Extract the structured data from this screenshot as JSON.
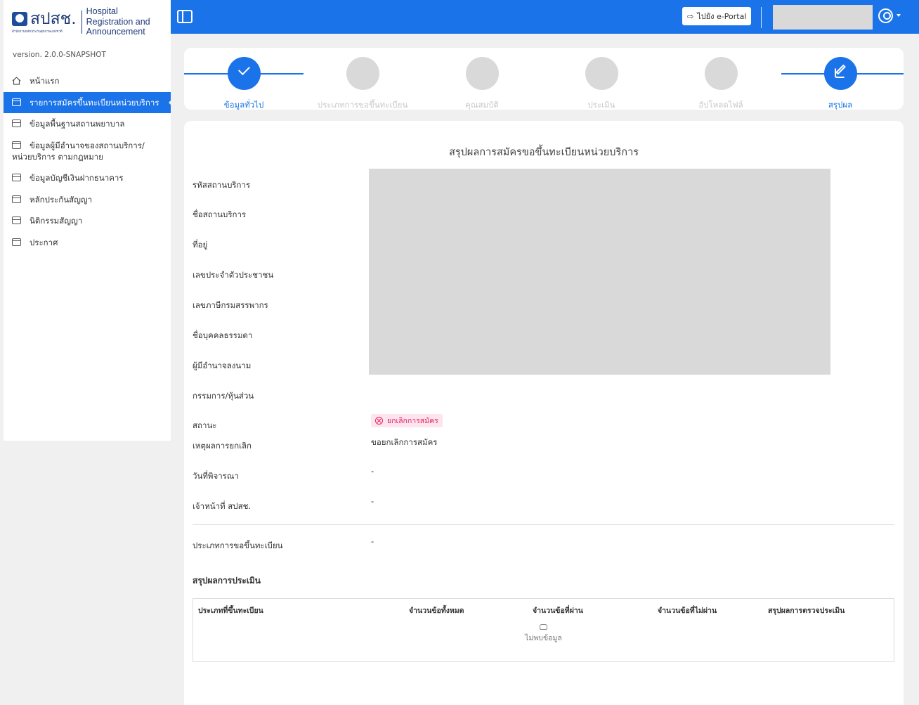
{
  "brand": {
    "logo_text": "สปสช.",
    "logo_subtext": "สำนักงานหลักประกันสุขภาพแห่งชาติ",
    "name_line1": "Hospital",
    "name_line2": "Registration and",
    "name_line3": "Announcement",
    "version": "version. 2.0.0-SNAPSHOT"
  },
  "sidebar": {
    "items": [
      {
        "label": "หน้าแรก",
        "icon": "home-icon"
      },
      {
        "label": "รายการสมัครขึ้นทะเบียนหน่วยบริการ",
        "icon": "card-icon",
        "active": true
      },
      {
        "label": "ข้อมูลพื้นฐานสถานพยาบาล",
        "icon": "card-icon"
      },
      {
        "label": "ข้อมูลผู้มีอำนาจของสถานบริการ/หน่วยบริการ ตามกฎหมาย",
        "icon": "card-icon"
      },
      {
        "label": "ข้อมูลบัญชีเงินฝากธนาคาร",
        "icon": "card-icon"
      },
      {
        "label": "หลักประกันสัญญา",
        "icon": "card-icon"
      },
      {
        "label": "นิติกรรมสัญญา",
        "icon": "card-icon"
      },
      {
        "label": "ประกาศ",
        "icon": "card-icon"
      }
    ]
  },
  "header": {
    "portal_button": "ไปยัง e-Portal",
    "accent": "#1a73e8"
  },
  "steps": [
    {
      "label": "ข้อมูลทั่วไป",
      "state": "done"
    },
    {
      "label": "ประเภทการขอขึ้นทะเบียน",
      "state": "pending"
    },
    {
      "label": "คุณสมบัติ",
      "state": "pending"
    },
    {
      "label": "ประเมิน",
      "state": "pending"
    },
    {
      "label": "อัปโหลดไฟล์",
      "state": "pending"
    },
    {
      "label": "สรุปผล",
      "state": "current"
    }
  ],
  "summary": {
    "title": "สรุปผลการสมัครขอขึ้นทะเบียนหน่วยบริการ",
    "fields": {
      "service_code": "รหัสสถานบริการ",
      "service_name": "ชื่อสถานบริการ",
      "address": "ที่อยู่",
      "citizen_id": "เลขประจำตัวประชาชน",
      "tax_id": "เลขภาษีกรมสรรพากร",
      "person_name": "ชื่อบุคคลธรรมดา",
      "signatory": "ผู้มีอำนาจลงนาม",
      "partners": "กรรมการ/หุ้นส่วน",
      "status": "สถานะ",
      "cancel_reason": "เหตุผลการยกเลิก",
      "review_date": "วันที่พิจารณา",
      "officer": "เจ้าหน้าที่ สปสช.",
      "registration_type": "ประเภทการขอขึ้นทะเบียน"
    },
    "values": {
      "status": "ยกเลิกการสมัคร",
      "status_color": "#e0245e",
      "cancel_reason": "ขอยกเลิกการสมัคร",
      "review_date": "-",
      "officer": "-",
      "registration_type": "-"
    }
  },
  "evaluation": {
    "title": "สรุปผลการประเมิน",
    "columns": [
      "ประเภทที่ขึ้นทะเบียน",
      "จำนวนข้อทั้งหมด",
      "จำนวนข้อที่ผ่าน",
      "จำนวนข้อที่ไม่ผ่าน",
      "สรุปผลการตรวจประเมิน"
    ],
    "empty_text": "ไม่พบข้อมูล"
  }
}
